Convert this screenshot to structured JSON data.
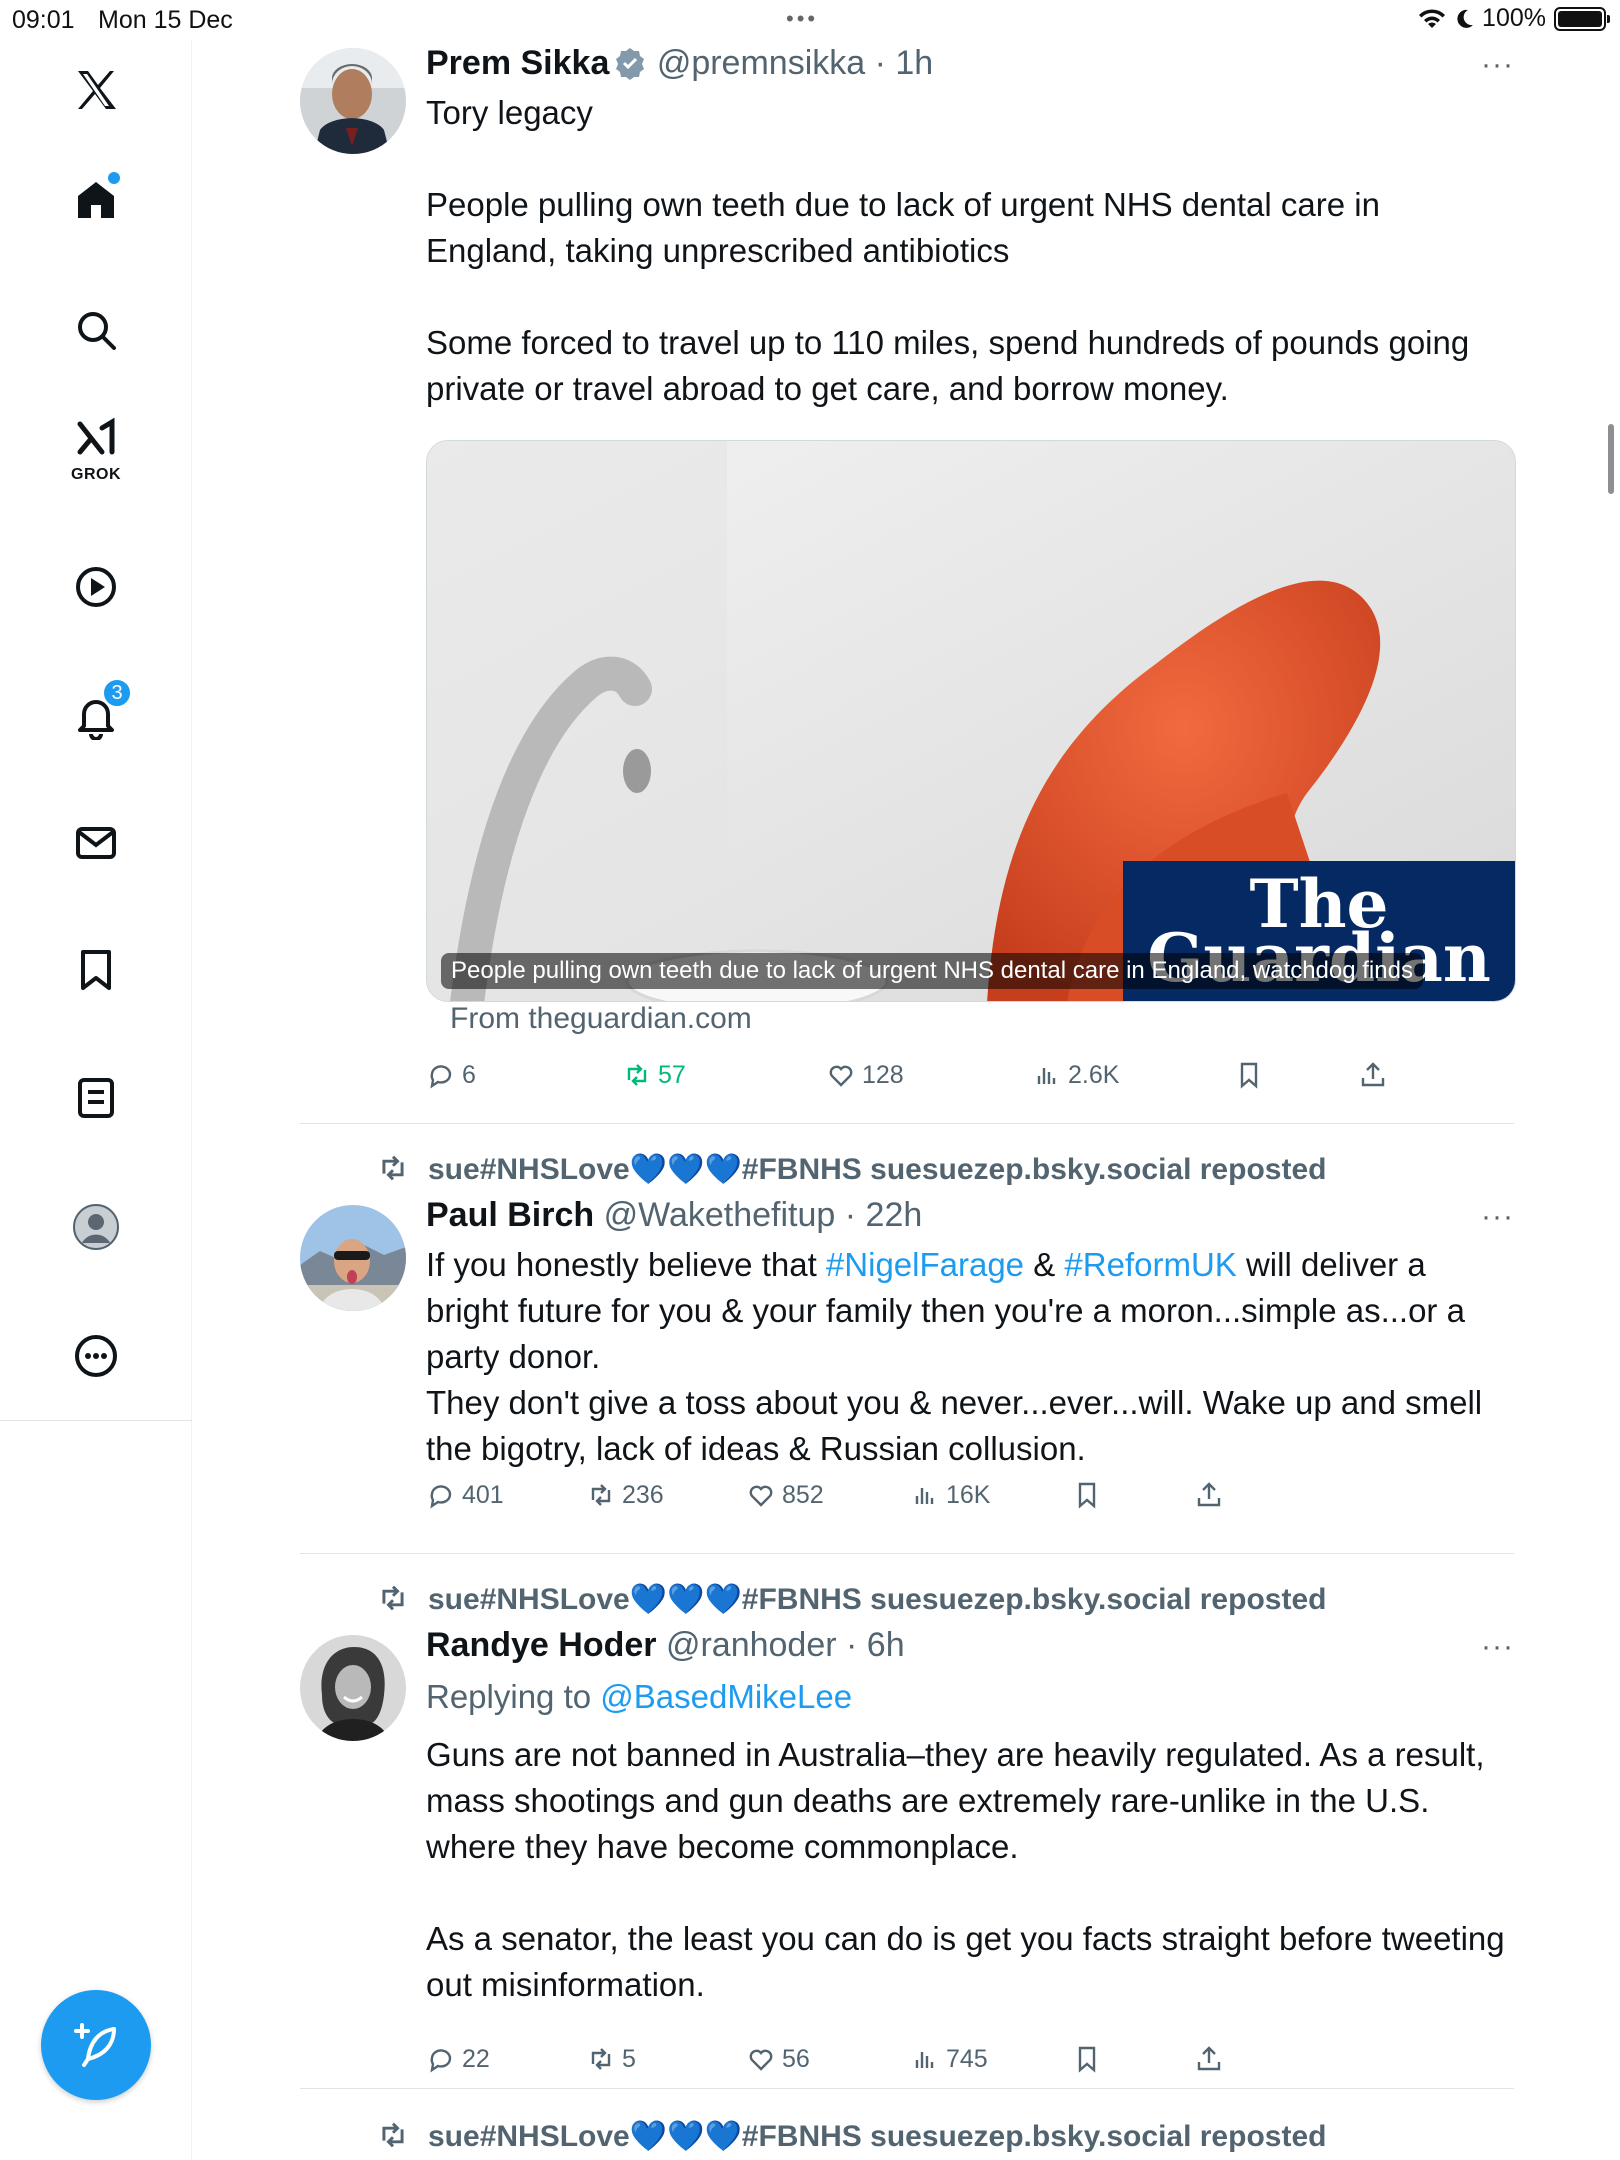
{
  "status": {
    "time": "09:01",
    "date": "Mon 15 Dec",
    "battery": "100%",
    "dots": "•••"
  },
  "sidebar": {
    "items": [
      {
        "name": "home",
        "label": ""
      },
      {
        "name": "search",
        "label": ""
      },
      {
        "name": "grok",
        "label": "GROK"
      },
      {
        "name": "video",
        "label": ""
      },
      {
        "name": "notifications",
        "label": "",
        "badge": "3"
      },
      {
        "name": "messages",
        "label": ""
      },
      {
        "name": "bookmarks",
        "label": ""
      },
      {
        "name": "lists",
        "label": ""
      },
      {
        "name": "profile",
        "label": ""
      },
      {
        "name": "more",
        "label": ""
      }
    ],
    "compose_label": ""
  },
  "tweets": [
    {
      "name": "Prem Sikka",
      "handle": "@premnsikka",
      "time": "· 1h",
      "verified": true,
      "text": "Tory legacy\n\nPeople pulling own teeth due to lack of urgent NHS dental care in England, taking unprescribed antibiotics\n\nSome forced to travel up to 110 miles, spend hundreds of pounds going private or travel abroad to get care, and borrow money.",
      "card": {
        "title": "People pulling own teeth due to lack of urgent NHS dental care in England, watchdog finds",
        "source": "From theguardian.com",
        "logo_line1": "The",
        "logo_line2": "Guardian"
      },
      "replies": "6",
      "reposts": "57",
      "likes": "128",
      "views": "2.6K"
    },
    {
      "reposted_by": "sue#NHSLove💙💙💙#FBNHS suesuezep.bsky.social reposted",
      "name": "Paul Birch",
      "handle": "@Wakethefitup",
      "time": "· 22h",
      "text_before": "If you honestly believe that ",
      "tag1": "#NigelFarage",
      "text_mid": " & ",
      "tag2": "#ReformUK",
      "text_after": " will deliver a bright future for you & your family then you're a moron...simple as...or a party donor.\nThey don't give a toss about you & never...ever...will. Wake up and smell the bigotry, lack of ideas & Russian collusion.",
      "replies": "401",
      "reposts": "236",
      "likes": "852",
      "views": "16K"
    },
    {
      "reposted_by": "sue#NHSLove💙💙💙#FBNHS suesuezep.bsky.social reposted",
      "name": "Randye Hoder",
      "handle": "@ranhoder",
      "time": "· 6h",
      "replying_prefix": "Replying to ",
      "replying_to": "@BasedMikeLee",
      "text": "Guns are not banned in Australia–they are heavily regulated. As a result, mass shootings and gun deaths are extremely rare-unlike in the U.S. where they have become commonplace.\n\nAs a senator, the least you can do is get you facts straight before tweeting out misinformation.",
      "replies": "22",
      "reposts": "5",
      "likes": "56",
      "views": "745"
    },
    {
      "reposted_by": "sue#NHSLove💙💙💙#FBNHS suesuezep.bsky.social reposted"
    }
  ],
  "colors": {
    "accent": "#1d9bf0",
    "repost_green": "#00ba7c",
    "secondary_text": "#536471",
    "guardian_blue": "#052962",
    "chair_orange": "#e8532a"
  }
}
